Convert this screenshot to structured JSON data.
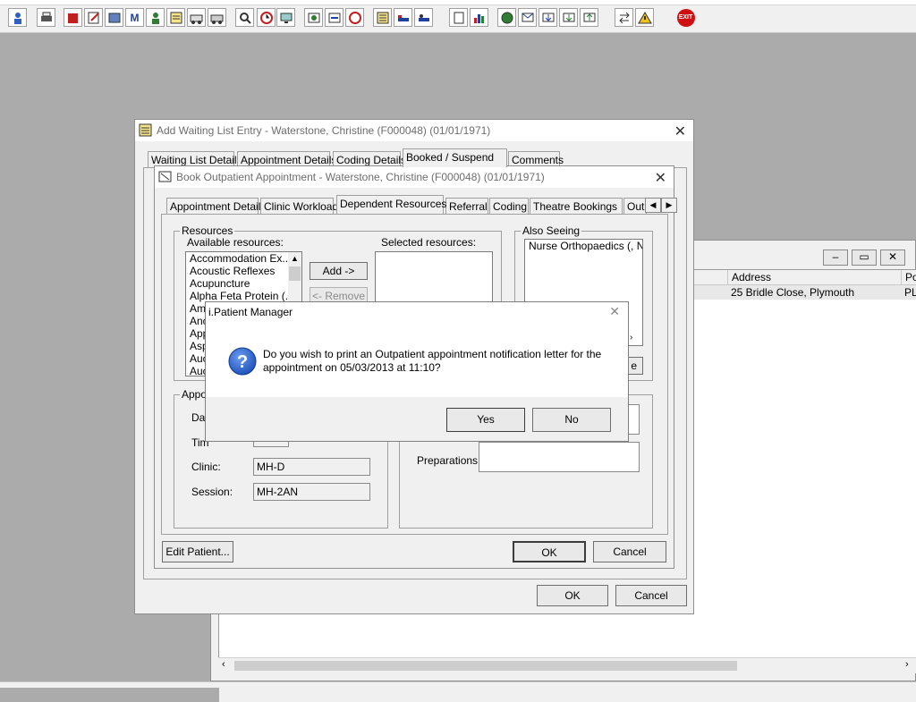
{
  "toolbar": {
    "exit_label": "EXIT"
  },
  "waiting_list": {
    "title": "Add Waiting List Entry - Waterstone, Christine (F000048) (01/01/1971)",
    "tabs": [
      "Waiting List Details",
      "Appointment Details",
      "Coding Details",
      "Booked / Suspend",
      "Comments"
    ],
    "ok_label": "OK",
    "cancel_label": "Cancel"
  },
  "book_appt": {
    "title": "Book Outpatient Appointment - Waterstone, Christine (F000048) (01/01/1971)",
    "tabs": [
      "Appointment Details",
      "Clinic Workload",
      "Dependent Resources",
      "Referral",
      "Coding",
      "Theatre Bookings",
      "Out"
    ],
    "resources_group": "Resources",
    "available_label": "Available resources:",
    "selected_label": "Selected resources:",
    "available_items": [
      "Accommodation Ex...",
      "Acoustic Reflexes",
      "Acupuncture",
      "Alpha Feta Protein (...",
      "Aml",
      "Anc",
      "App",
      "Asp",
      "Auc",
      "Auc"
    ],
    "add_label": "Add ->",
    "remove_label": "<- Remove",
    "also_seeing_group": "Also Seeing",
    "also_seeing_items": [
      "Nurse Orthopaedics (, NLC"
    ],
    "also_seeing_btn_fragment": "e",
    "appt_group": "Appo",
    "da_label": "Da",
    "tim_label": "Tim",
    "clinic_label": "Clinic:",
    "clinic_value": "MH-D",
    "session_label": "Session:",
    "session_value": "MH-2AN",
    "preparations_label": "Preparations:",
    "edit_patient_label": "Edit Patient...",
    "ok_label": "OK",
    "cancel_label": "Cancel"
  },
  "background_list": {
    "address_header": "Address",
    "po_header": "Po",
    "row_address": "25 Bridle Close, Plymouth",
    "row_po": "PL"
  },
  "msgbox": {
    "title": "i.Patient Manager",
    "message": "Do you wish to print an Outpatient appointment notification letter for the appointment on 05/03/2013 at 11:10?",
    "yes_label": "Yes",
    "no_label": "No"
  }
}
